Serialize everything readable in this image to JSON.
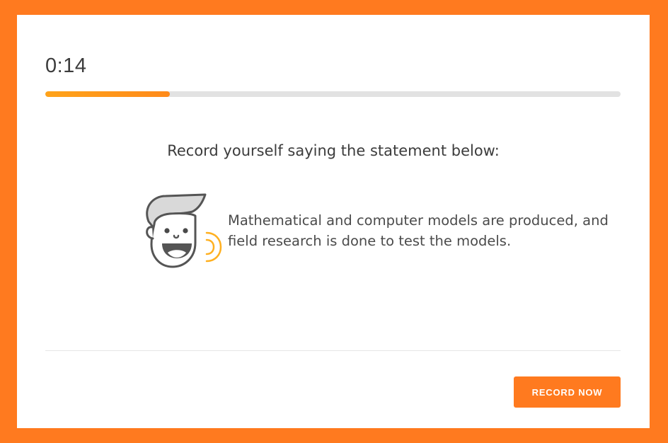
{
  "timer": {
    "elapsed": "0:14"
  },
  "progress": {
    "fraction": 0.217,
    "fill_color": "#ff8a1a",
    "track_color": "#e2e2e2"
  },
  "prompt": {
    "instruction": "Record yourself saying the statement below:",
    "statement": "Mathematical and computer models are produced, and field research is done to test the models.",
    "avatar_icon": "speaking-face-icon"
  },
  "actions": {
    "record_label": "RECORD NOW"
  },
  "colors": {
    "accent": "#ff7a1f",
    "text_primary": "#3c3c3c",
    "sound_wave": "#ffb020"
  }
}
